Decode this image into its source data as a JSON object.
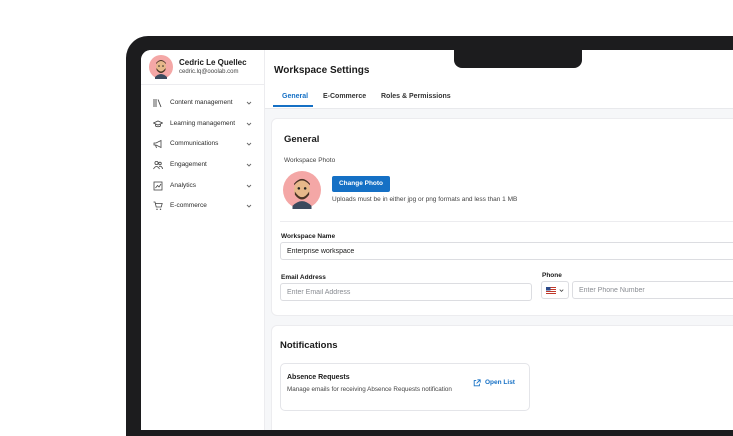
{
  "profile": {
    "name": "Cedric Le Quellec",
    "email": "cedric.lq@ooolab.com"
  },
  "sidebar": {
    "items": [
      {
        "label": "Content management",
        "icon": "library-icon"
      },
      {
        "label": "Learning management",
        "icon": "graduation-cap-icon"
      },
      {
        "label": "Communications",
        "icon": "megaphone-icon"
      },
      {
        "label": "Engagement",
        "icon": "users-icon"
      },
      {
        "label": "Analytics",
        "icon": "chart-icon"
      },
      {
        "label": "E-commerce",
        "icon": "cart-icon"
      }
    ]
  },
  "header": {
    "title": "Workspace Settings",
    "tabs": [
      {
        "label": "General",
        "active": true
      },
      {
        "label": "E-Commerce",
        "active": false
      },
      {
        "label": "Roles & Permissions",
        "active": false
      }
    ]
  },
  "general": {
    "title": "General",
    "photo_label": "Workspace Photo",
    "change_photo_label": "Change Photo",
    "upload_hint": "Uploads must be in either jpg or png formats and less than 1 MB",
    "workspace_name_label": "Workspace Name",
    "workspace_name_value": "Enterprise workspace",
    "email_label": "Email Address",
    "email_placeholder": "Enter Email Address",
    "phone_label": "Phone",
    "phone_placeholder": "Enter Phone Number",
    "phone_country": "US"
  },
  "notifications": {
    "title": "Notifications",
    "absence": {
      "title": "Absence Requests",
      "description": "Manage emails for receiving Absence Requests notification",
      "action_label": "Open List"
    }
  },
  "colors": {
    "accent": "#1570c5",
    "avatar_bg": "#f4a7a6"
  }
}
